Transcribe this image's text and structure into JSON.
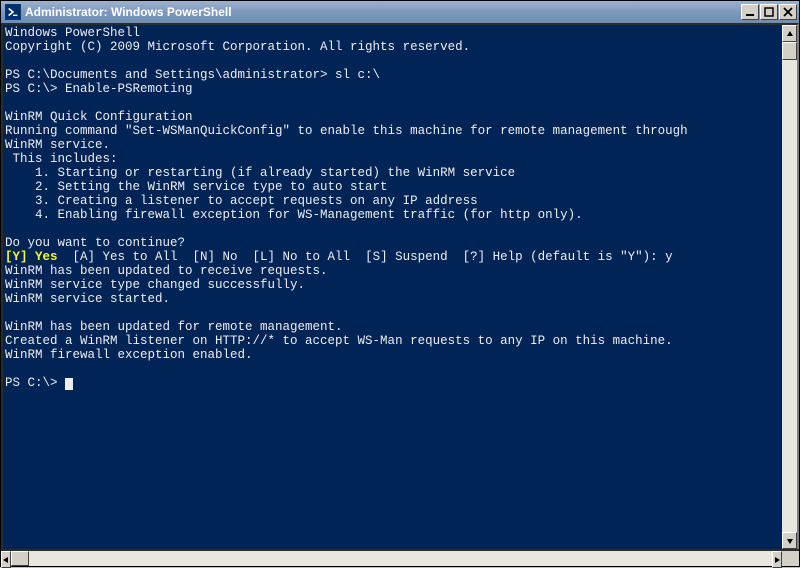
{
  "window": {
    "title": "Administrator: Windows PowerShell"
  },
  "console": {
    "lines": [
      "Windows PowerShell",
      "Copyright (C) 2009 Microsoft Corporation. All rights reserved.",
      "",
      "PS C:\\Documents and Settings\\administrator> sl c:\\",
      "PS C:\\> Enable-PSRemoting",
      "",
      "WinRM Quick Configuration",
      "Running command \"Set-WSManQuickConfig\" to enable this machine for remote management through",
      "WinRM service.",
      " This includes:",
      "    1. Starting or restarting (if already started) the WinRM service",
      "    2. Setting the WinRM service type to auto start",
      "    3. Creating a listener to accept requests on any IP address",
      "    4. Enabling firewall exception for WS-Management traffic (for http only).",
      "",
      "Do you want to continue?"
    ],
    "prompt_highlight": "[Y] Yes",
    "prompt_rest": "  [A] Yes to All  [N] No  [L] No to All  [S] Suspend  [?] Help (default is \"Y\"): y",
    "lines2": [
      "WinRM has been updated to receive requests.",
      "WinRM service type changed successfully.",
      "WinRM service started.",
      "",
      "WinRM has been updated for remote management.",
      "Created a WinRM listener on HTTP://* to accept WS-Man requests to any IP on this machine.",
      "WinRM firewall exception enabled.",
      ""
    ],
    "final_prompt": "PS C:\\> "
  }
}
